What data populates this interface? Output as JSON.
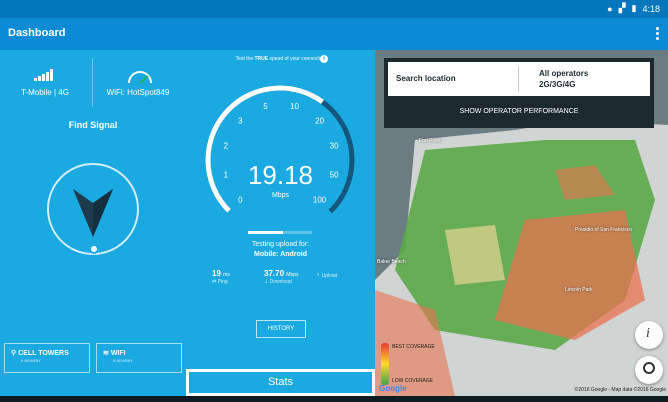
{
  "status_bar": {
    "time": "4:18"
  },
  "app_bar": {
    "title": "Dashboard"
  },
  "left_panel": {
    "carrier": "T-Mobile | 4G",
    "wifi": "WiFi: HotSpot849",
    "find_signal": "Find Signal",
    "cell_towers": {
      "label": "CELL TOWERS",
      "sub": "6 NEARBY"
    },
    "wifi_btn": {
      "label": "WIFI",
      "sub": "6 NEARBY"
    }
  },
  "speed_panel": {
    "note_prefix": "Test the ",
    "note_bold": "TRUE",
    "note_suffix": " speed of your connection",
    "speed": "19.18",
    "unit": "Mbps",
    "gauge_ticks": [
      "0",
      "1",
      "2",
      "3",
      "5",
      "10",
      "20",
      "30",
      "50",
      "100"
    ],
    "upload_progress": 0.55,
    "testing_line1": "Testing upload for:",
    "testing_line2": "Mobile: Android",
    "ping": {
      "value": "19",
      "unit": "ms",
      "label": "Ping"
    },
    "download": {
      "value": "37.70",
      "unit": "Mbps",
      "label": "Download"
    },
    "upload": {
      "label": "Upload"
    },
    "history": "HISTORY",
    "stats_tab": "Stats"
  },
  "map": {
    "search_label": "Search location",
    "operators": "All operators",
    "networks": "2G/3G/4G",
    "show_perf": "SHOW OPERATOR PERFORMANCE",
    "labels": [
      "Fort Point",
      "Baker Beach",
      "Presidio of San Francisco",
      "Lincoln Park"
    ],
    "legend_high": "BEST COVERAGE",
    "legend_low": "LOW COVERAGE",
    "copyright": "©2016 Google - Map data ©2016 Google",
    "google": "Google"
  }
}
